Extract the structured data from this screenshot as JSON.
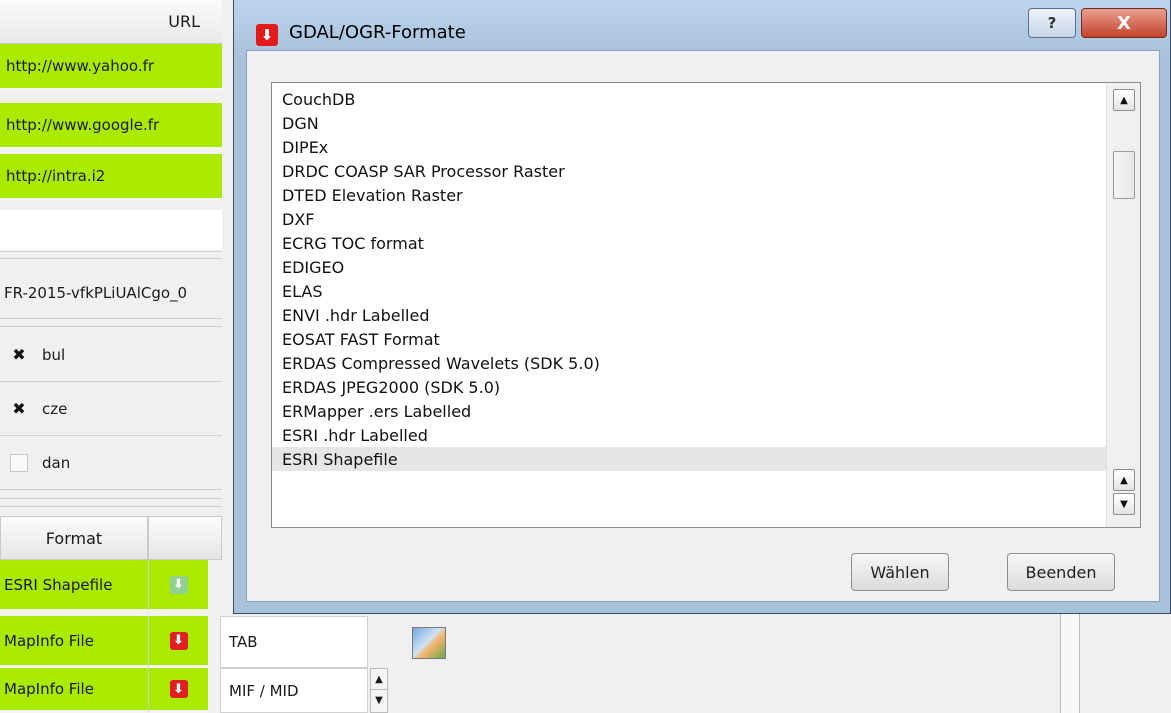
{
  "background_app": {
    "url_header": "URL",
    "url_rows": [
      "http://www.yahoo.fr",
      "http://www.google.fr",
      "http://intra.i2"
    ],
    "id_field": "FR-2015-vfkPLiUAlCgo_0",
    "languages": [
      {
        "label": "bul",
        "checked": true
      },
      {
        "label": "cze",
        "checked": true
      },
      {
        "label": "dan",
        "checked": false
      }
    ],
    "format_header": "Format",
    "format_rows": [
      {
        "name": "ESRI Shapefile",
        "icon": "download-icon-green",
        "ext": ""
      },
      {
        "name": "MapInfo File",
        "icon": "download-icon-red",
        "ext": "TAB"
      },
      {
        "name": "MapInfo File",
        "icon": "download-icon-red",
        "ext": "MIF / MID"
      }
    ]
  },
  "dialog": {
    "title": "GDAL/OGR-Formate",
    "help_label": "?",
    "close_label": "X",
    "list_items": [
      "CouchDB",
      "DGN",
      "DIPEx",
      "DRDC COASP SAR Processor Raster",
      "DTED Elevation Raster",
      "DXF",
      "ECRG TOC format",
      "EDIGEO",
      "ELAS",
      "ENVI .hdr Labelled",
      "EOSAT FAST Format",
      "ERDAS Compressed Wavelets (SDK 5.0)",
      "ERDAS JPEG2000 (SDK 5.0)",
      "ERMapper .ers Labelled",
      "ESRI .hdr Labelled",
      "ESRI Shapefile"
    ],
    "selected_item": "ESRI Shapefile",
    "choose_button": "Wählen",
    "quit_button": "Beenden"
  },
  "colors": {
    "row_highlight": "#aaea00",
    "title_icon": "#e21b1b",
    "close_button": "#c2422a"
  }
}
